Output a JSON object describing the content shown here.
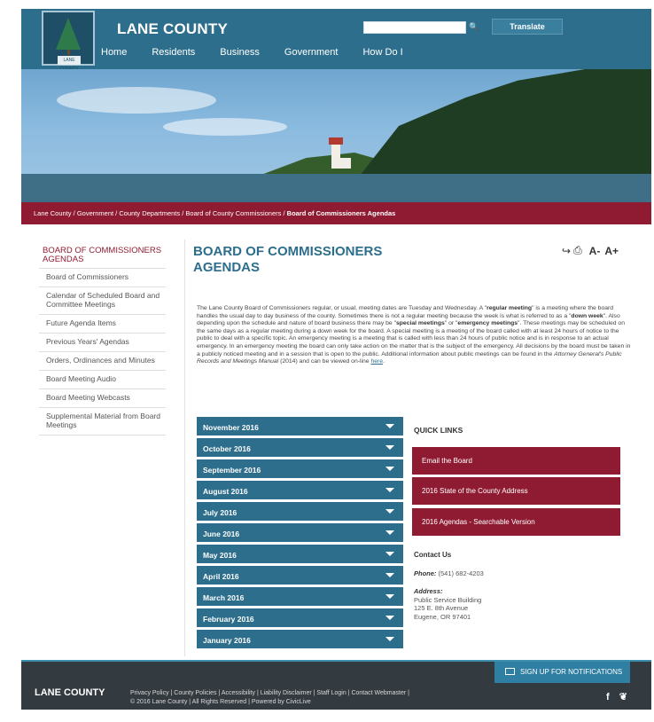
{
  "header": {
    "brand": "LANE COUNTY",
    "logo_text": "LANE COUNTY",
    "nav": [
      "Home",
      "Residents",
      "Business",
      "Government",
      "How Do I"
    ],
    "search": {
      "placeholder": "",
      "icon": "search-icon"
    },
    "translate_label": "Translate"
  },
  "breadcrumb": {
    "items": [
      "Lane County",
      "Government",
      "County Departments",
      "Board of County Commissioners"
    ],
    "current": "Board of Commissioners Agendas",
    "separator": " / "
  },
  "sidebar": {
    "title": "BOARD OF COMMISSIONERS AGENDAS",
    "items": [
      "Board of Commissioners",
      "Calendar of Scheduled Board and Committee Meetings",
      "Future Agenda Items",
      "Previous Years' Agendas",
      "Orders, Ordinances and Minutes",
      "Board Meeting Audio",
      "Board Meeting Webcasts",
      "Supplemental Material from Board Meetings"
    ]
  },
  "main": {
    "title": "BOARD OF COMMISSIONERS AGENDAS",
    "tools": {
      "share_icon": "share-icon",
      "print_icon": "print-icon",
      "decrease": "A-",
      "increase": "A+"
    },
    "paragraph": {
      "p1": "The Lane County Board of Commissioners regular, or usual, meeting dates are Tuesday and Wednesday. A \"",
      "regular": "regular meeting",
      "p2": "\" is a meeting where the board handles the usual day to day business of the county. Sometimes there is not a regular meeting because the week is what is referred to as a \"",
      "down": "down week",
      "p3": "\". Also depending upon the schedule and nature of board business there may be \"",
      "special": "special meetings",
      "p4": "\" or \"",
      "emergency": "emergency meetings",
      "p5": "\". These meetings may be scheduled on the same days as a regular meeting during a down week for the board. A special meeting is a meeting of the board called with at least 24 hours of notice to the public to deal with a specific topic. An emergency meeting is a meeting that is called with less than 24 hours of public notice and is in response to an actual emergency. In an emergency meeting the board can only take action on the matter that is the subject of the emergency. All decisions by the board must be taken in a publicly noticed meeting and in a session that is open to the public. Additional information about public meetings can be found in the ",
      "manual": "Attorney General's Public Records and Meetings Manual",
      "p6": " (2014) and can be viewed on-line ",
      "link": "here",
      "p7": "."
    },
    "months": [
      "November 2016",
      "October 2016",
      "September 2016",
      "August 2016",
      "July 2016",
      "June 2016",
      "May 2016",
      "April 2016",
      "March 2016",
      "February 2016",
      "January 2016"
    ],
    "quick_links": {
      "title": "QUICK LINKS",
      "items": [
        "Email the Board",
        "2016 State of the County Address",
        "2016 Agendas - Searchable Version"
      ]
    },
    "contact": {
      "title": "Contact Us",
      "phone_label": "Phone:",
      "phone": "(541) 682-4203",
      "address_label": "Address:",
      "address_lines": [
        "Public Service Building",
        "125 E. 8th Avenue",
        "Eugene, OR 97401"
      ]
    }
  },
  "footer": {
    "signup": "SIGN UP FOR NOTIFICATIONS",
    "brand": "LANE COUNTY",
    "links": [
      "Privacy Policy",
      "County Policies",
      "Accessibility",
      "Liability Disclaimer",
      "Staff Login",
      "Contact Webmaster"
    ],
    "copyright": [
      "© 2016 Lane County",
      "All Rights Reserved",
      "Powered by CivicLive"
    ],
    "social": [
      "f",
      "❦"
    ]
  },
  "colors": {
    "teal": "#2c6e8c",
    "maroon": "#8e1b32",
    "footer": "#333a40"
  }
}
